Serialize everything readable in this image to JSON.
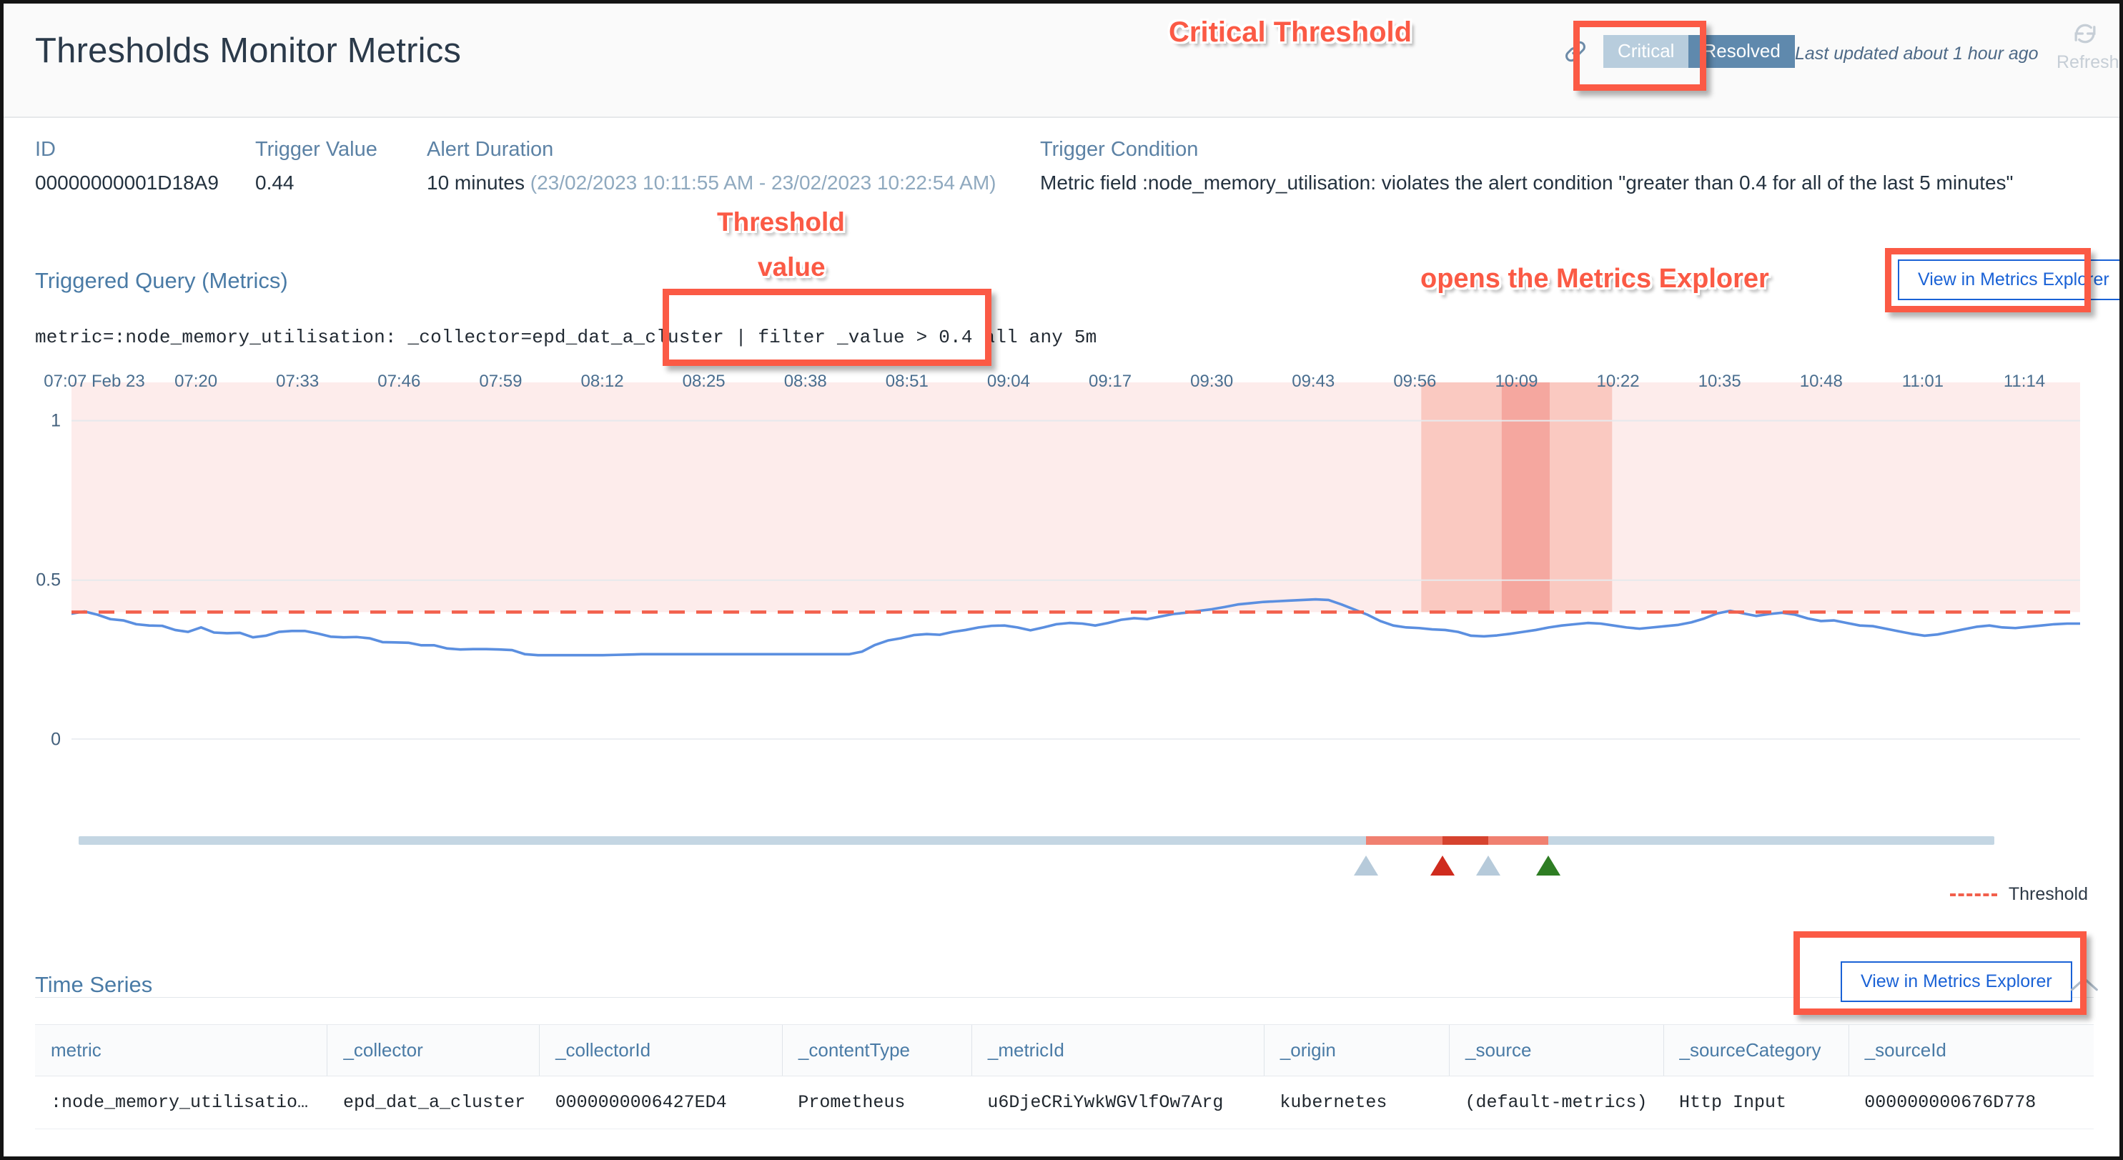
{
  "header": {
    "title": "Thresholds Monitor Metrics",
    "link_icon": "link-icon",
    "segments": [
      {
        "label": "Critical",
        "active": true
      },
      {
        "label": "Resolved",
        "active": false
      }
    ],
    "last_updated": "Last updated about 1 hour ago",
    "refresh_label": "Refresh",
    "refresh_icon": "refresh-icon"
  },
  "meta": {
    "id_label": "ID",
    "id_value": "00000000001D18A9",
    "trigger_value_label": "Trigger Value",
    "trigger_value": "0.44",
    "alert_duration_label": "Alert Duration",
    "alert_duration": "10 minutes",
    "alert_duration_range": "(23/02/2023 10:11:55 AM - 23/02/2023 10:22:54 AM)",
    "trigger_condition_label": "Trigger Condition",
    "trigger_condition": "Metric field :node_memory_utilisation: violates the alert condition \"greater than 0.4 for all of the last 5 minutes\""
  },
  "triggered_query": {
    "title": "Triggered Query (Metrics)",
    "query_prefix": "metric=:node_memory_utilisation: _collector=epd_dat_a_cluster | ",
    "query_filter": "filter _value > 0.4 all any 5m",
    "view_button": "View in Metrics Explorer"
  },
  "time_series": {
    "title": "Time Series",
    "view_button": "View in Metrics Explorer",
    "collapse_icon": "chevron-up-icon",
    "columns": [
      "metric",
      "_collector",
      "_collectorId",
      "_contentType",
      "_metricId",
      "_origin",
      "_source",
      "_sourceCategory",
      "_sourceId"
    ],
    "rows": [
      [
        ":node_memory_utilisatio…",
        "epd_dat_a_cluster",
        "0000000006427ED4",
        "Prometheus",
        "u6DjeCRiYwkWGVlfOw7Arg",
        "kubernetes",
        "(default-metrics)",
        "Http Input",
        "000000000676D778"
      ]
    ]
  },
  "annotations": [
    {
      "id": "anno-critical-threshold",
      "text": "Critical Threshold"
    },
    {
      "id": "anno-threshold-value-1",
      "text": "Threshold"
    },
    {
      "id": "anno-threshold-value-2",
      "text": "value"
    },
    {
      "id": "anno-opens-explorer",
      "text": "opens the Metrics Explorer"
    }
  ],
  "colors": {
    "accent_blue": "#1a62d6",
    "label_blue": "#4a7ba6",
    "line_blue": "#5b8fe0",
    "threshold_red": "#f2604c",
    "annotation_red": "#fb5a45",
    "violation_band": "#fdeceb",
    "alert_band_light": "#f9c5bd",
    "alert_band_dark": "#f4a097",
    "segment_active": "#b8cddd",
    "segment_inactive": "#5f89ad",
    "marker_green": "#2e7d23",
    "marker_red": "#cf2b1e",
    "marker_blue": "#b6cada"
  },
  "chart_data": {
    "type": "line",
    "title": "",
    "xlabel": "",
    "ylabel": "",
    "ylim": [
      0,
      1.12
    ],
    "yticks": [
      0,
      0.5,
      1
    ],
    "ytick_labels": [
      "0",
      "0.5",
      "1"
    ],
    "grid": true,
    "legend": [
      {
        "label": "Threshold",
        "style": "dashed",
        "color": "#f2604c"
      }
    ],
    "legend_position": "bottom-right",
    "threshold": 0.4,
    "threshold_label": "Threshold",
    "violation_band": {
      "from": 0.4,
      "to": 1.12,
      "color": "#fdeceb"
    },
    "alert_window": {
      "start": "10:04",
      "end": "10:24",
      "critical_start": "10:11:55",
      "critical_end": "10:22:54"
    },
    "xticks": [
      "07:07 Feb 23",
      "07:20",
      "07:33",
      "07:46",
      "07:59",
      "08:12",
      "08:25",
      "08:38",
      "08:51",
      "09:04",
      "09:17",
      "09:30",
      "09:43",
      "09:56",
      "10:09",
      "10:22",
      "10:35",
      "10:48",
      "11:01",
      "11:14"
    ],
    "series": [
      {
        "name": ":node_memory_utilisation:",
        "color": "#5b8fe0",
        "values": [
          0.395,
          0.402,
          0.392,
          0.378,
          0.374,
          0.362,
          0.358,
          0.357,
          0.344,
          0.338,
          0.352,
          0.336,
          0.334,
          0.335,
          0.321,
          0.326,
          0.338,
          0.341,
          0.341,
          0.333,
          0.323,
          0.321,
          0.322,
          0.318,
          0.306,
          0.305,
          0.304,
          0.296,
          0.296,
          0.286,
          0.283,
          0.284,
          0.284,
          0.283,
          0.281,
          0.268,
          0.265,
          0.265,
          0.265,
          0.265,
          0.265,
          0.265,
          0.266,
          0.267,
          0.268,
          0.268,
          0.268,
          0.268,
          0.268,
          0.268,
          0.268,
          0.268,
          0.268,
          0.268,
          0.268,
          0.268,
          0.268,
          0.268,
          0.268,
          0.268,
          0.268,
          0.276,
          0.297,
          0.311,
          0.318,
          0.328,
          0.331,
          0.329,
          0.338,
          0.344,
          0.352,
          0.357,
          0.358,
          0.352,
          0.343,
          0.352,
          0.362,
          0.366,
          0.364,
          0.358,
          0.366,
          0.376,
          0.381,
          0.378,
          0.386,
          0.394,
          0.398,
          0.404,
          0.409,
          0.416,
          0.424,
          0.428,
          0.432,
          0.434,
          0.436,
          0.438,
          0.44,
          0.438,
          0.424,
          0.408,
          0.392,
          0.372,
          0.358,
          0.352,
          0.35,
          0.346,
          0.344,
          0.338,
          0.326,
          0.324,
          0.327,
          0.332,
          0.338,
          0.344,
          0.352,
          0.358,
          0.362,
          0.366,
          0.364,
          0.358,
          0.352,
          0.348,
          0.352,
          0.356,
          0.36,
          0.368,
          0.38,
          0.396,
          0.404,
          0.396,
          0.388,
          0.394,
          0.398,
          0.392,
          0.38,
          0.372,
          0.374,
          0.366,
          0.358,
          0.356,
          0.348,
          0.34,
          0.332,
          0.326,
          0.33,
          0.338,
          0.346,
          0.354,
          0.358,
          0.352,
          0.35,
          0.354,
          0.358,
          0.362,
          0.364,
          0.364
        ]
      }
    ],
    "markers": [
      {
        "position": 0.672,
        "color": "#b6cada",
        "type": "warning-start"
      },
      {
        "position": 0.712,
        "color": "#cf2b1e",
        "type": "critical"
      },
      {
        "position": 0.736,
        "color": "#b6cada",
        "type": "warning-end"
      },
      {
        "position": 0.767,
        "color": "#2e7d23",
        "type": "resolved"
      }
    ]
  }
}
